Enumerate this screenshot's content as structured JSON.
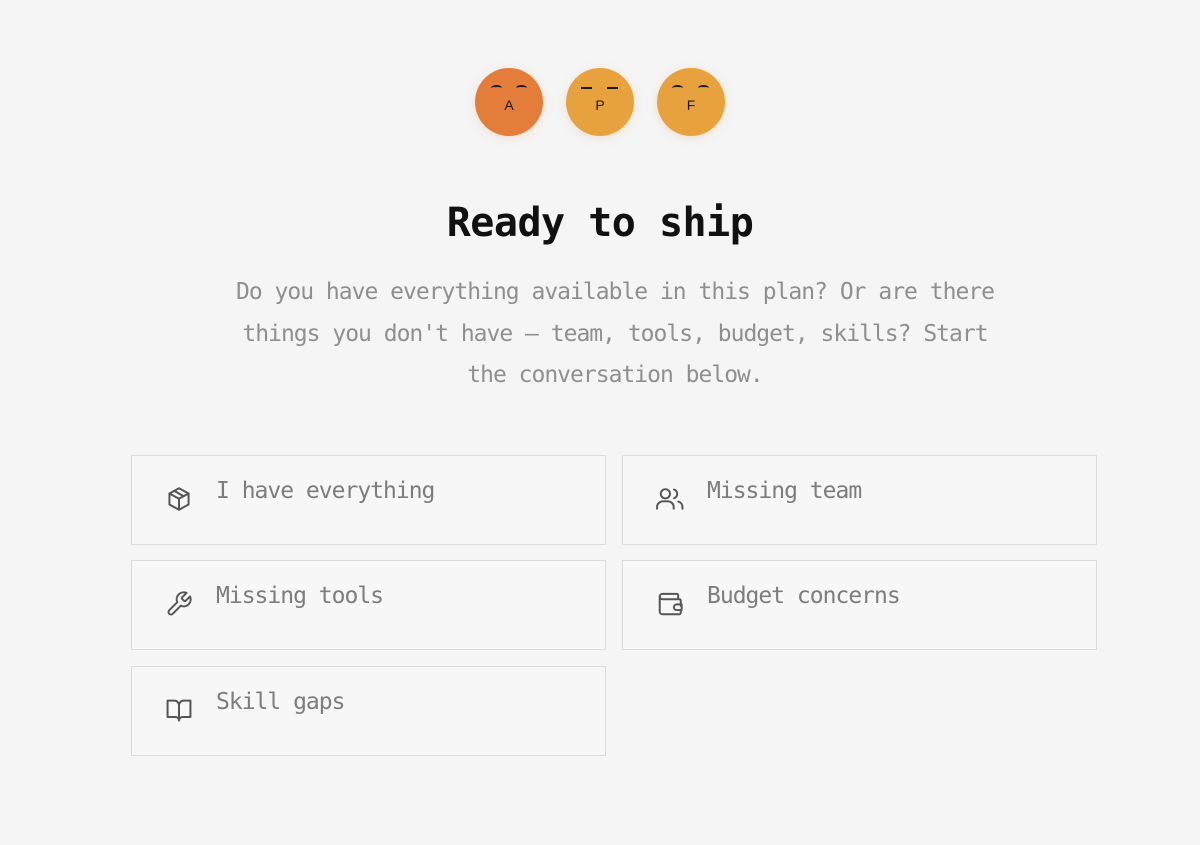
{
  "avatars": [
    {
      "initial": "A",
      "color": "#e47d39",
      "eyes": "curved"
    },
    {
      "initial": "P",
      "color": "#e8a23d",
      "eyes": "flat"
    },
    {
      "initial": "F",
      "color": "#e8a23d",
      "eyes": "curved"
    }
  ],
  "heading": "Ready to ship",
  "subtitle": "Do you have everything available in this plan? Or are there things you don't have — team, tools, budget, skills? Start the conversation below.",
  "options": [
    {
      "label": "I have everything",
      "icon": "package-icon"
    },
    {
      "label": "Missing team",
      "icon": "users-icon"
    },
    {
      "label": "Missing tools",
      "icon": "wrench-icon"
    },
    {
      "label": "Budget concerns",
      "icon": "wallet-icon"
    },
    {
      "label": "Skill gaps",
      "icon": "book-icon"
    }
  ],
  "colors": {
    "background": "#f5f5f5",
    "heading": "#111111",
    "muted_text": "#8f8f8f",
    "card_border": "#dcdcdc",
    "icon_stroke": "#555555"
  }
}
